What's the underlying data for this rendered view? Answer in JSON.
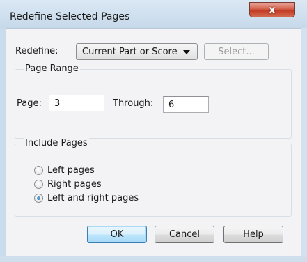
{
  "window": {
    "title": "Redefine Selected Pages",
    "close_glyph": "x"
  },
  "redefine": {
    "label": "Redefine:",
    "selected_option": "Current Part or Score",
    "select_button": "Select..."
  },
  "page_range": {
    "group_label": "Page Range",
    "page_label": "Page:",
    "page_value": "3",
    "through_label": "Through:",
    "through_value": "6"
  },
  "include_pages": {
    "group_label": "Include Pages",
    "options": [
      {
        "label": "Left pages",
        "checked": false
      },
      {
        "label": "Right pages",
        "checked": false
      },
      {
        "label": "Left and right pages",
        "checked": true
      }
    ]
  },
  "buttons": {
    "ok": "OK",
    "cancel": "Cancel",
    "help": "Help"
  },
  "colors": {
    "title_bar": "#c6d9ea",
    "close": "#c23b23",
    "default_button": "#3c7fb1"
  },
  "icons": {
    "close": "close-icon",
    "combo_arrow": "chevron-down-icon"
  }
}
